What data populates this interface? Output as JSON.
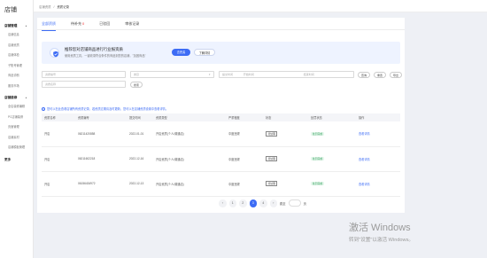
{
  "sidebar": {
    "logo": "店铺",
    "groups": [
      {
        "title": "店铺管理",
        "items": [
          "店铺信息",
          "店铺资质",
          "店铺体检",
          "子账号管理",
          "商品诊断",
          "服务市场"
        ]
      },
      {
        "title": "店铺装修",
        "items": [
          "全店装修编辑",
          "PC店铺装修",
          "页面管理",
          "店铺素材",
          "店铺模板管理"
        ]
      }
    ],
    "more": "更多"
  },
  "breadcrumb": {
    "parent": "店铺资质",
    "separator": "/",
    "current": "资质记录"
  },
  "tabs": [
    {
      "label": "全部资质"
    },
    {
      "label": "待补充",
      "badge": "0"
    },
    {
      "label": "已驳回"
    },
    {
      "label": "审核记录"
    }
  ],
  "banner": {
    "title": "推荐您对店铺商品进行行业报资质",
    "subtitle": "使用资质工具，一键收录符合条件的商品到您的店铺，\"加固商品\"",
    "primary_btn": "去完善",
    "secondary_btn": "了解详情"
  },
  "filters": {
    "f1": "资质编号",
    "f2": "类目",
    "f3": "提交时间",
    "f4": "开始时间",
    "f5": "结束时间",
    "f6": "资质名称",
    "btn_query": "查询",
    "btn_reset": "重置",
    "btn_export": "导出",
    "btn_search": "搜索"
  },
  "hint": "您可以在此查看店铺所有资质记录，若资质过期请及时更新，您可以在店铺资质设置中查看详情。",
  "table": {
    "headers": [
      "资质名称",
      "资质编号",
      "提交时间",
      "资质类型",
      "严重程度",
      "状态",
      "处罚状态",
      "操作"
    ],
    "rows": [
      [
        "开店",
        "06211420858",
        "2022-01-01",
        "开店资质(个人/普通店)",
        "中度违规",
        "待处理",
        "处罚完成",
        "查看详情"
      ],
      [
        "开店",
        "06211602218",
        "2022-12-16",
        "开店资质(个人/普通店)",
        "中度违规",
        "待处理",
        "处罚完成",
        "查看详情"
      ],
      [
        "开店",
        "06156434972",
        "2022-12-13",
        "开店资质(个人/普通店)",
        "中度违规",
        "待处理",
        "处罚完成",
        "查看详情"
      ]
    ]
  },
  "pager": {
    "pages": [
      "1",
      "2",
      "3",
      "4"
    ],
    "current": "3",
    "prev": "‹",
    "next": "›",
    "goto_label": "跳至",
    "page_suffix": "页"
  },
  "watermark": {
    "line1": "激活 Windows",
    "line2": "转到\"设置\"以激活 Windows。"
  },
  "colors": {
    "accent": "#3d6cf5",
    "success": "#2f9e5b"
  }
}
